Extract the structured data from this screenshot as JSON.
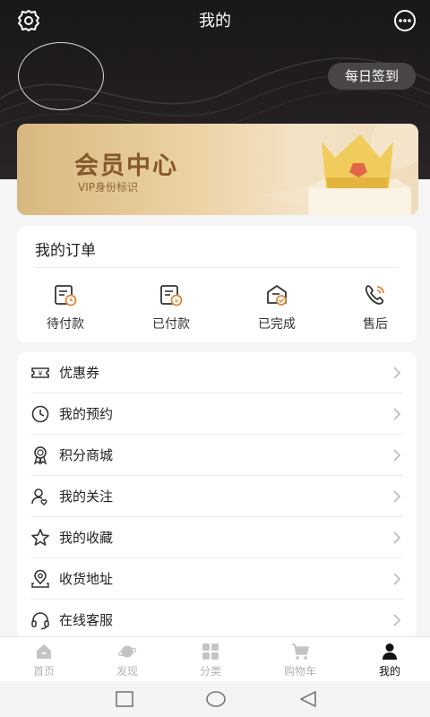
{
  "header": {
    "title": "我的",
    "checkin_label": "每日签到"
  },
  "vip": {
    "title": "会员中心",
    "subtitle": "VIP身份标识"
  },
  "orders": {
    "title": "我的订单",
    "items": [
      {
        "label": "待付款",
        "icon": "pending-payment-icon"
      },
      {
        "label": "已付款",
        "icon": "paid-icon"
      },
      {
        "label": "已完成",
        "icon": "completed-icon"
      },
      {
        "label": "售后",
        "icon": "after-sales-icon"
      }
    ]
  },
  "menu": {
    "items": [
      {
        "label": "优惠券",
        "icon": "coupon-icon"
      },
      {
        "label": "我的预约",
        "icon": "clock-icon"
      },
      {
        "label": "积分商城",
        "icon": "medal-icon"
      },
      {
        "label": "我的关注",
        "icon": "user-follow-icon"
      },
      {
        "label": "我的收藏",
        "icon": "star-icon"
      },
      {
        "label": "收货地址",
        "icon": "location-icon"
      },
      {
        "label": "在线客服",
        "icon": "headset-icon"
      }
    ]
  },
  "tabbar": {
    "items": [
      {
        "label": "首页",
        "icon": "home-icon"
      },
      {
        "label": "发现",
        "icon": "planet-icon"
      },
      {
        "label": "分类",
        "icon": "grid-icon"
      },
      {
        "label": "购物车",
        "icon": "cart-icon"
      },
      {
        "label": "我的",
        "icon": "person-icon"
      }
    ],
    "active_index": 4
  },
  "colors": {
    "hero_bg": "#1f1b1c",
    "vip_text": "#86582b",
    "accent": "#e0883a",
    "inactive_tab": "#b3b3b3"
  }
}
